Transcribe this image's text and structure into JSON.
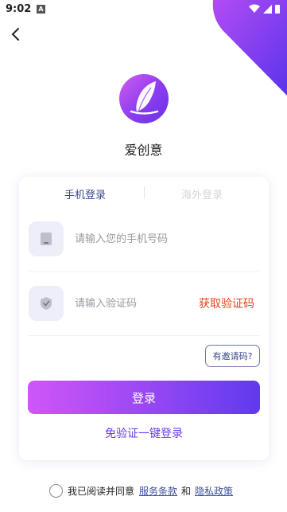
{
  "status_bar": {
    "time": "9:02",
    "indicator": "A"
  },
  "app": {
    "name": "爱创意"
  },
  "tabs": {
    "phone_login": "手机登录",
    "overseas_login": "海外登录"
  },
  "phone_field": {
    "placeholder": "请输入您的手机号码",
    "value": ""
  },
  "code_field": {
    "placeholder": "请输入验证码",
    "value": ""
  },
  "get_code_label": "获取验证码",
  "invite_label": "有邀请码?",
  "login_label": "登录",
  "quick_login_label": "免验证一键登录",
  "agreement": {
    "text": "我已阅读并同意",
    "terms_link": "服务条款",
    "and": "和",
    "privacy_link": "隐私政策"
  },
  "colors": {
    "accent": "#7a3ef0",
    "brand_gradient_start": "#cf56f8",
    "brand_gradient_end": "#5f3aee",
    "get_code": "#e8451f",
    "tab_active": "#3a4a8a"
  }
}
